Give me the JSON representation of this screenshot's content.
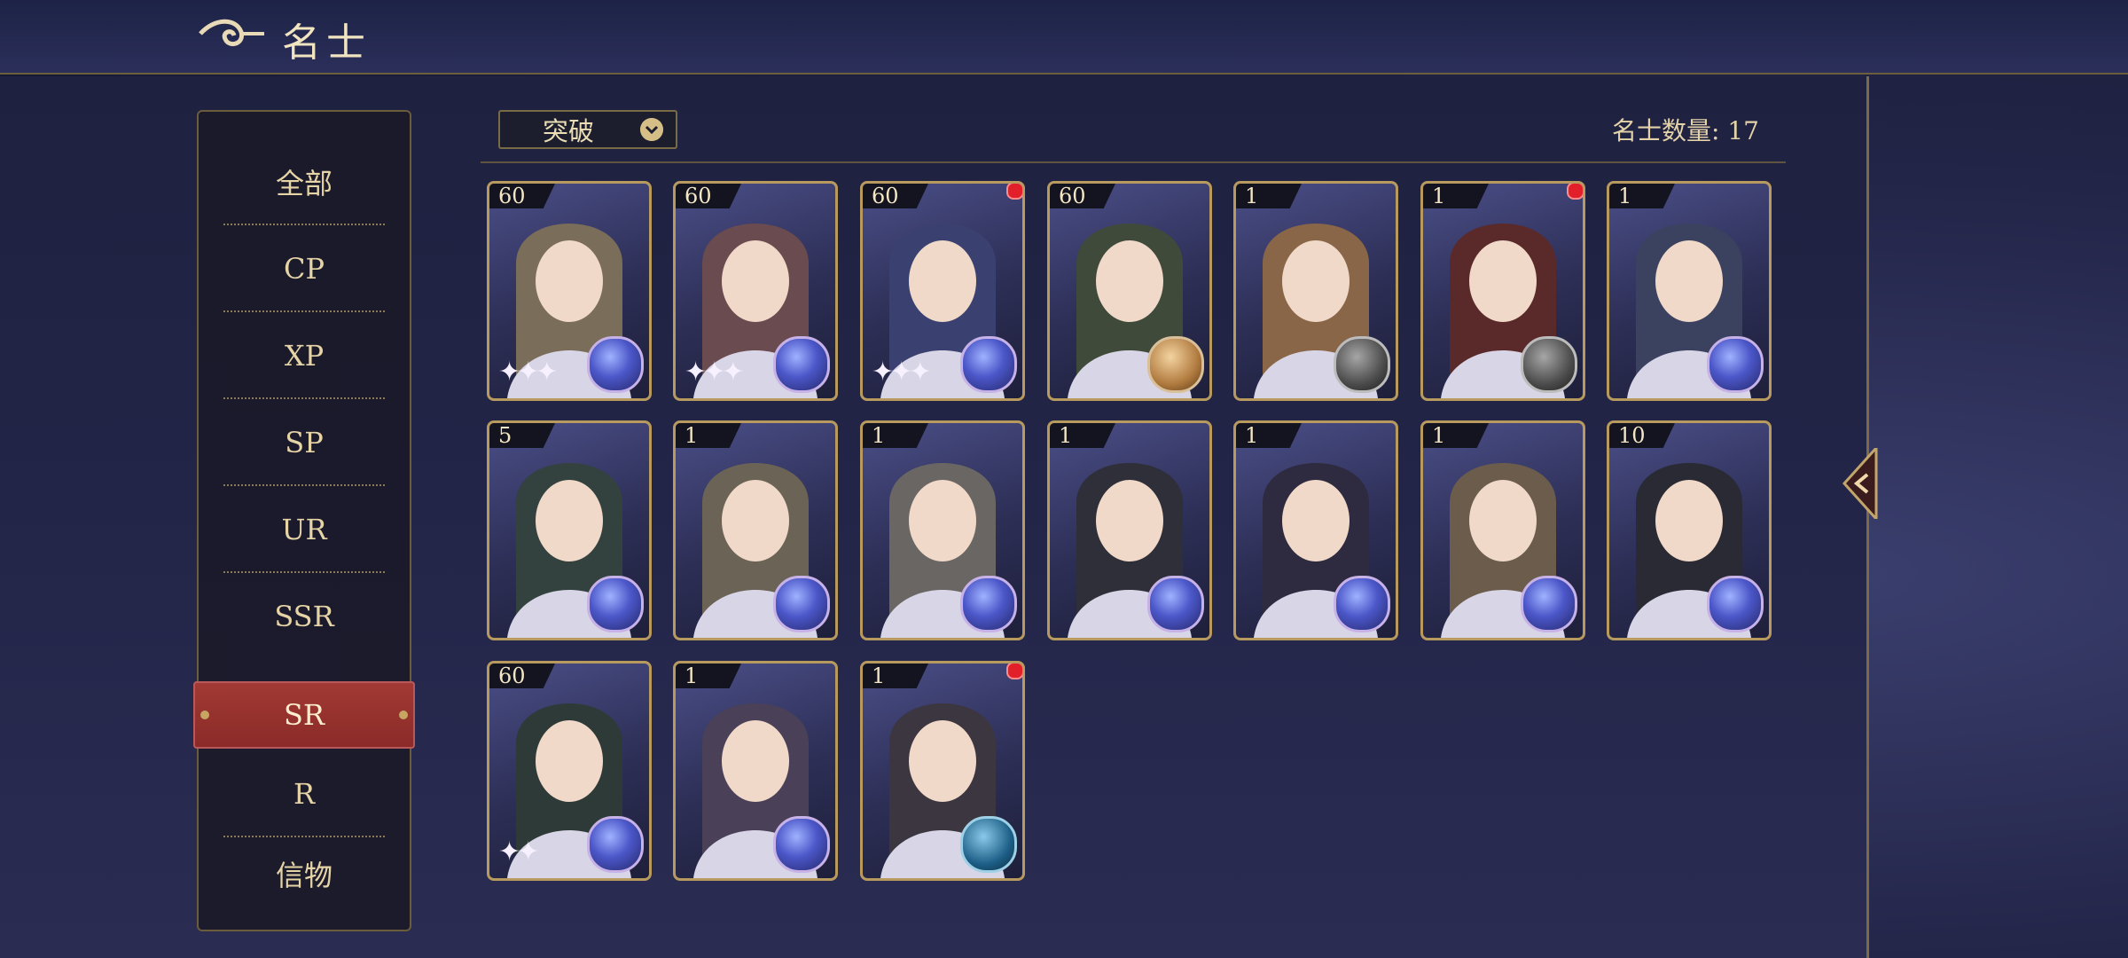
{
  "header": {
    "title": "名士",
    "ornament_icon": "cloud-scroll-icon"
  },
  "category_menu": {
    "items": [
      {
        "label": "全部"
      },
      {
        "label": "CP"
      },
      {
        "label": "XP"
      },
      {
        "label": "SP"
      },
      {
        "label": "UR"
      },
      {
        "label": "SSR"
      },
      {
        "label": "SR",
        "active": true
      },
      {
        "label": "R"
      },
      {
        "label": "信物"
      }
    ]
  },
  "toolbar": {
    "filter_label": "突破",
    "filter_icon": "chevron-down-icon",
    "count_text": "名士数量: 17"
  },
  "cards": [
    {
      "level": "60",
      "stars": "✦✦✦",
      "orb": "blue"
    },
    {
      "level": "60",
      "stars": "✦✦✦",
      "orb": "blue"
    },
    {
      "level": "60",
      "stars": "✦✦✦",
      "orb": "blue",
      "badge": true
    },
    {
      "level": "60",
      "stars": "",
      "orb": "bronze"
    },
    {
      "level": "1",
      "stars": "",
      "orb": "gray"
    },
    {
      "level": "1",
      "stars": "",
      "orb": "gray",
      "badge": true
    },
    {
      "level": "1",
      "stars": "",
      "orb": "blue"
    },
    {
      "level": "5",
      "stars": "",
      "orb": "blue"
    },
    {
      "level": "1",
      "stars": "",
      "orb": "blue"
    },
    {
      "level": "1",
      "stars": "",
      "orb": "blue"
    },
    {
      "level": "1",
      "stars": "",
      "orb": "blue"
    },
    {
      "level": "1",
      "stars": "",
      "orb": "blue"
    },
    {
      "level": "1",
      "stars": "",
      "orb": "blue"
    },
    {
      "level": "10",
      "stars": "",
      "orb": "blue"
    },
    {
      "level": "60",
      "stars": "✦✦",
      "orb": "blue"
    },
    {
      "level": "1",
      "stars": "",
      "orb": "blue"
    },
    {
      "level": "1",
      "stars": "",
      "orb": "teal",
      "badge": true
    }
  ],
  "colors": {
    "accent_red": "#a23a34",
    "gold_border": "#b89a5e",
    "badge_red": "#e2202a"
  },
  "collapse_icon": "chevron-left-icon"
}
